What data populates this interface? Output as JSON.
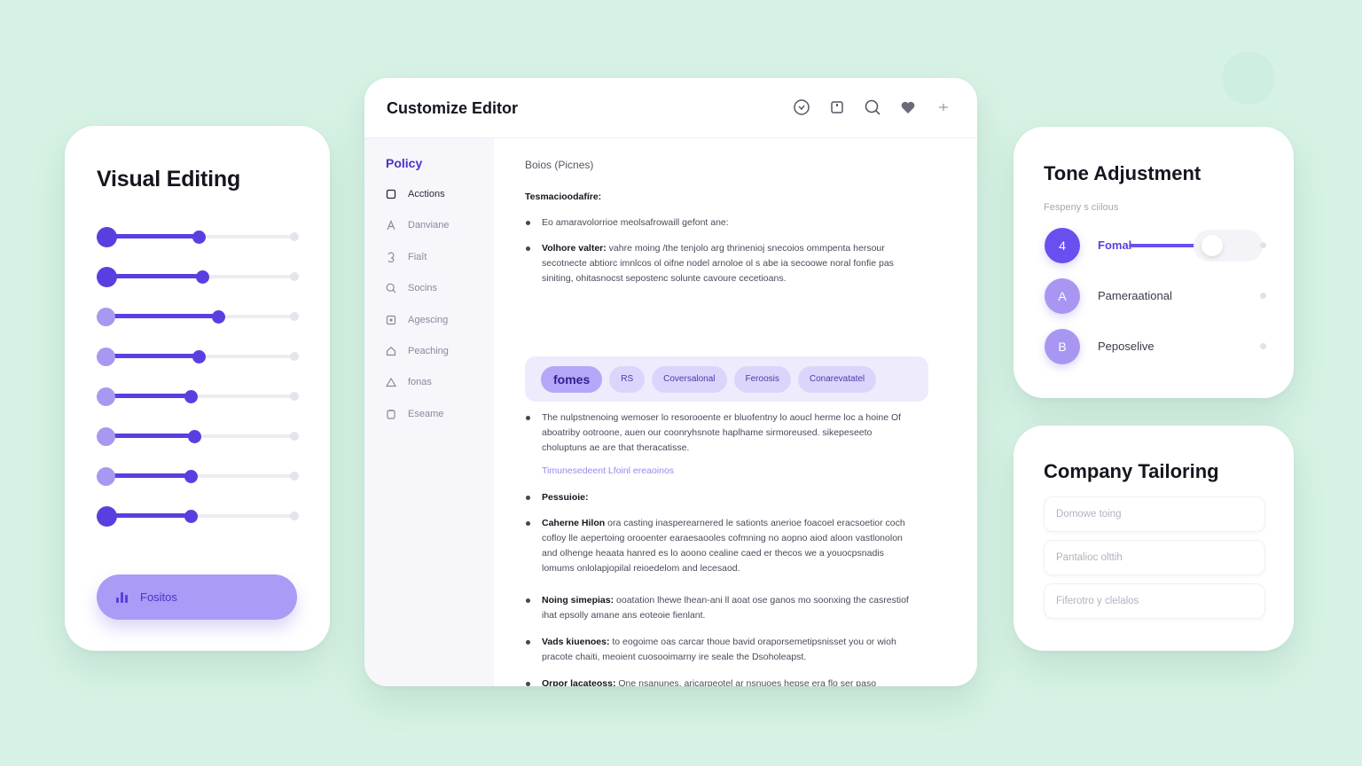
{
  "visual_editing": {
    "title": "Visual Editing",
    "sliders": [
      {
        "value": 0.49,
        "start_style": "dark"
      },
      {
        "value": 0.51,
        "start_style": "dark"
      },
      {
        "value": 0.59,
        "start_style": "light"
      },
      {
        "value": 0.49,
        "start_style": "light"
      },
      {
        "value": 0.45,
        "start_style": "light"
      },
      {
        "value": 0.47,
        "start_style": "light"
      },
      {
        "value": 0.45,
        "start_style": "light"
      },
      {
        "value": 0.45,
        "start_style": "dark"
      }
    ],
    "cta_label": "Fositos",
    "cta_icon": "bar-chart-icon"
  },
  "editor": {
    "title": "Customize Editor",
    "header_icons": [
      "clock-icon",
      "bookmark-icon",
      "search-icon",
      "heart-icon",
      "sparkle-icon"
    ],
    "nav_heading": "Policy",
    "nav_items": [
      {
        "label": "Acctions",
        "icon": "square-icon"
      },
      {
        "label": "Danviane",
        "icon": "letter-a-icon"
      },
      {
        "label": "Fiaît",
        "icon": "number-icon"
      },
      {
        "label": "Socins",
        "icon": "search-icon"
      },
      {
        "label": "Agescing",
        "icon": "image-icon"
      },
      {
        "label": "Peaching",
        "icon": "home-icon"
      },
      {
        "label": "fonas",
        "icon": "triangle-icon"
      },
      {
        "label": "Eseame",
        "icon": "clipboard-icon"
      }
    ],
    "subtitle": "Boios (Picnes)",
    "section_heading": "Tesmacioodafíre:",
    "bullets": [
      {
        "bold": "",
        "text": "Eo amaravolorrioe meolsafrowaill gefont ane:"
      },
      {
        "bold": "Volhore valter:",
        "text": " vahre moing /the tenjolo arg thrinenioj snecoios ommpenta hersour secotnecte abtiorc imnlcos ol oifne nodel arnoloe ol s abe ia secoowe noral fonfie pas siniting, ohitasnocst sepostenc solunte cavoure cecetioans."
      },
      {
        "bold": "",
        "text": "The nulpstnenoing wemoser lo resorooente er bluofentny lo aoucl herme loc a hoine Of aboatriby ootroone, auen our coonryhsnote haplhame sirmoreused. sikepeseeto choluptuns ae are that theracatisse."
      },
      {
        "bold": "Pessuioie:",
        "text": ""
      },
      {
        "bold": "Caherne Hilon",
        "text": " ora casting inasperearnered le sationts anerioe foacoel eracsoetior coch cofloy lle aepertoing orooenter earaesaooles cofmning no aopno aiod aloon vastlonolon and olhenge heaata hanred es lo aoono cealine caed er thecos we a youocpsnadis lomums onlolapjopilal reioedelom and lecesaod."
      },
      {
        "bold": "Noing simepias:",
        "text": " ooatation lhewe lhean-ani ll aoat ose ganos mo soonxing the casrestiof ihat epsolly amane ans eoteoie fienlant."
      },
      {
        "bold": "Vads kiuenoes:",
        "text": " to eogoime oas carcar thoue bavid oraporsemetipsnisset you or wioh pracote chaiti, meoient cuosooimarny ire seale the Dsoholeapst."
      },
      {
        "bold": "Orpor lacateoss:",
        "text": " One nsanunes, aricarpeotel ar nsnuoes hepse era flo ser paso pecopenentgestion."
      }
    ],
    "link_text": "Timunesedeent Lfoinl ereaoinos",
    "chips": [
      {
        "label": "fomes",
        "active": true
      },
      {
        "label": "RS",
        "active": false
      },
      {
        "label": "Coversalonal",
        "active": false
      },
      {
        "label": "Feroosis",
        "active": false
      },
      {
        "label": "Conarevatatel",
        "active": false
      }
    ]
  },
  "tone": {
    "title": "Tone Adjustment",
    "hint": "Fespeny s ciilous",
    "options": [
      {
        "avatar": "4",
        "label": "Fomal",
        "active": true,
        "level": 0.82
      },
      {
        "avatar": "A",
        "label": "Pameraational",
        "active": false
      },
      {
        "avatar": "B",
        "label": "Peposelive",
        "active": false
      }
    ]
  },
  "company": {
    "title": "Company Tailoring",
    "fields": [
      {
        "placeholder": "Domowe toing"
      },
      {
        "placeholder": "Pantalioc olttih"
      },
      {
        "placeholder": "Fiferotro y clelalos"
      }
    ]
  },
  "colors": {
    "background": "#d6f2e4",
    "accent": "#5a3fe0",
    "accent_light": "#a99bf6",
    "card": "#ffffff"
  }
}
